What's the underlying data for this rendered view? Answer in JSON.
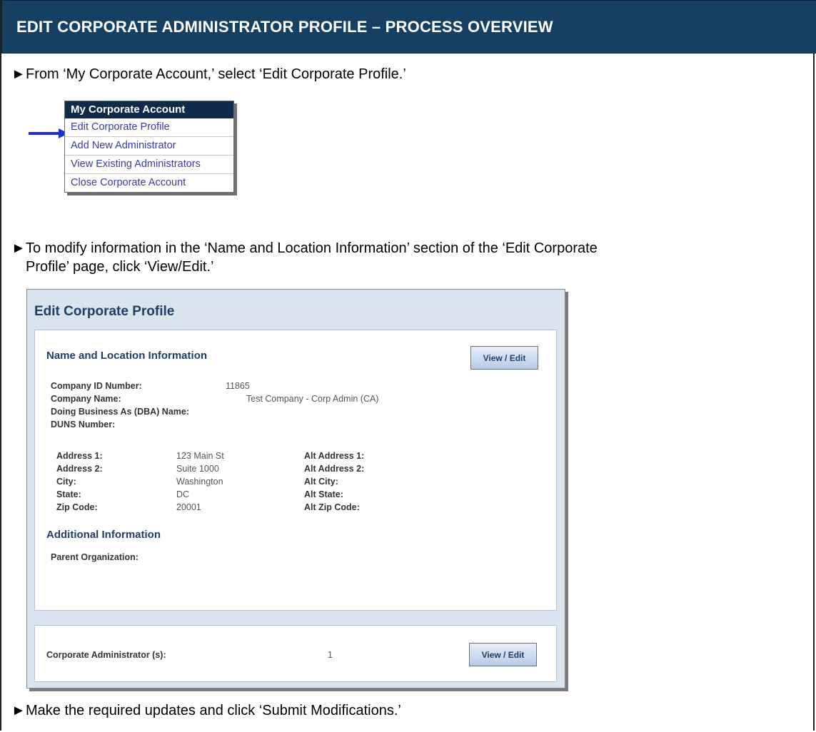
{
  "header": {
    "title": "EDIT CORPORATE ADMINISTRATOR PROFILE – PROCESS OVERVIEW"
  },
  "bullets": {
    "arrow": "►",
    "b1": "From ‘My Corporate Account,’ select ‘Edit Corporate Profile.’",
    "b2_line1": "To modify information in the ‘Name and Location Information’ section of the ‘Edit Corporate",
    "b2_line2": "Profile’ page, click ‘View/Edit.’",
    "b3": "Make the required updates and click ‘Submit Modifications.’"
  },
  "menu": {
    "header": "My Corporate Account",
    "items": [
      {
        "label": "Edit Corporate Profile"
      },
      {
        "label": "Add New Administrator"
      },
      {
        "label": "View Existing Administrators"
      },
      {
        "label": "Close Corporate Account"
      }
    ]
  },
  "edit_profile": {
    "title": "Edit Corporate Profile",
    "name_section_title": "Name and Location Information",
    "view_edit_label": "View / Edit",
    "fields": {
      "company_id_label": "Company ID Number:",
      "company_id_value": "11865",
      "company_name_label": "Company Name:",
      "company_name_value": "Test Company - Corp Admin (CA)",
      "dba_label": "Doing Business As (DBA) Name:",
      "duns_label": "DUNS Number:",
      "address1_label": "Address 1:",
      "address1_value": "123 Main St",
      "address2_label": "Address 2:",
      "address2_value": "Suite 1000",
      "city_label": "City:",
      "city_value": "Washington",
      "state_label": "State:",
      "state_value": "DC",
      "zip_label": "Zip Code:",
      "zip_value": "20001",
      "alt_address1_label": "Alt Address 1:",
      "alt_address2_label": "Alt Address 2:",
      "alt_city_label": "Alt City:",
      "alt_state_label": "Alt State:",
      "alt_zip_label": "Alt Zip Code:"
    },
    "additional_section_title": "Additional Information",
    "parent_org_label": "Parent Organization:",
    "corp_admin_label": "Corporate Administrator (s):",
    "corp_admin_count": "1"
  },
  "colors": {
    "header_bg": "#153f63",
    "menu_header_bg": "#0f2a4a",
    "link": "#3a3aa8",
    "section_title": "#1e3e66",
    "pointer_arrow": "#1f2fd4"
  },
  "icons": {
    "bullet": "triangle-right-icon",
    "pointer": "arrow-right-icon"
  }
}
